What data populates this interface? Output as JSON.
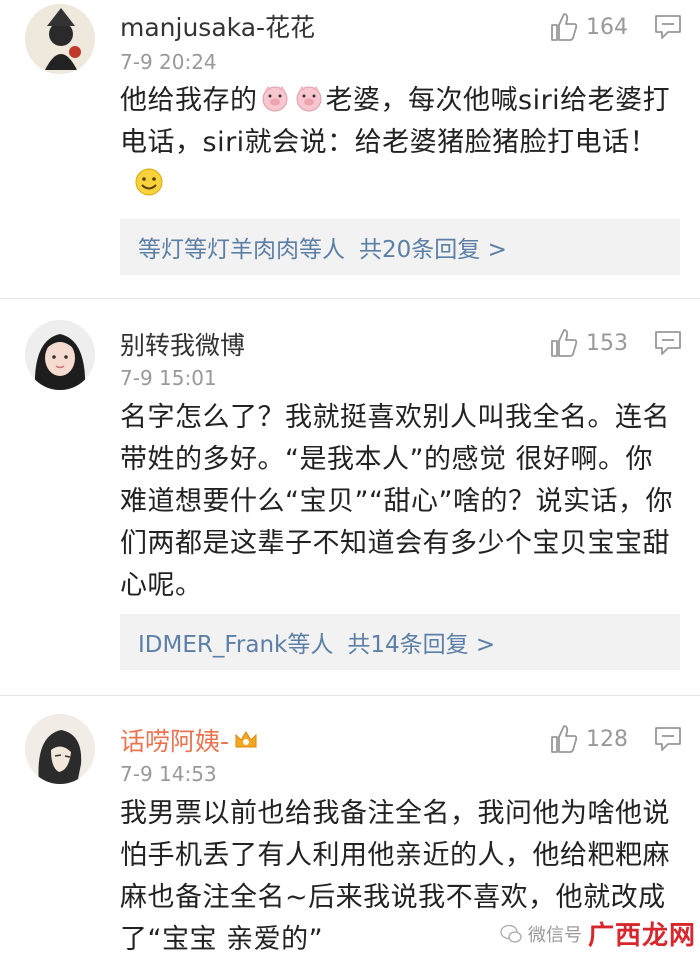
{
  "comments": [
    {
      "name": "manjusaka-花花",
      "time": "7-9 20:24",
      "likes": "164",
      "text_a": "他给我存的",
      "text_b": "老婆，每次他喊siri给老婆打电话，siri就会说：给老婆猪脸猪脸打电话！",
      "replies_who": "等灯等灯羊肉肉等人",
      "replies_count": "共20条回复 >"
    },
    {
      "name": "别转我微博",
      "time": "7-9 15:01",
      "likes": "153",
      "text": "名字怎么了？我就挺喜欢别人叫我全名。连名带姓的多好。“是我本人”的感觉 很好啊。你难道想要什么“宝贝”“甜心”啥的？说实话，你们两都是这辈子不知道会有多少个宝贝宝宝甜心呢。",
      "replies_who": "IDMER_Frank等人",
      "replies_count": "共14条回复 >"
    },
    {
      "name": "话唠阿姨-",
      "time": "7-9 14:53",
      "likes": "128",
      "text": "我男票以前也给我备注全名，我问他为啥他说怕手机丢了有人利用他亲近的人，他给粑粑麻麻也备注全名~后来我说我不喜欢，他就改成了“宝宝 亲爱的”"
    }
  ],
  "watermark": {
    "text": "微信号",
    "brand": "广西龙网"
  },
  "colors": {
    "link": "#5c7fa6",
    "vip": "#eb7350",
    "meta": "#999999"
  }
}
